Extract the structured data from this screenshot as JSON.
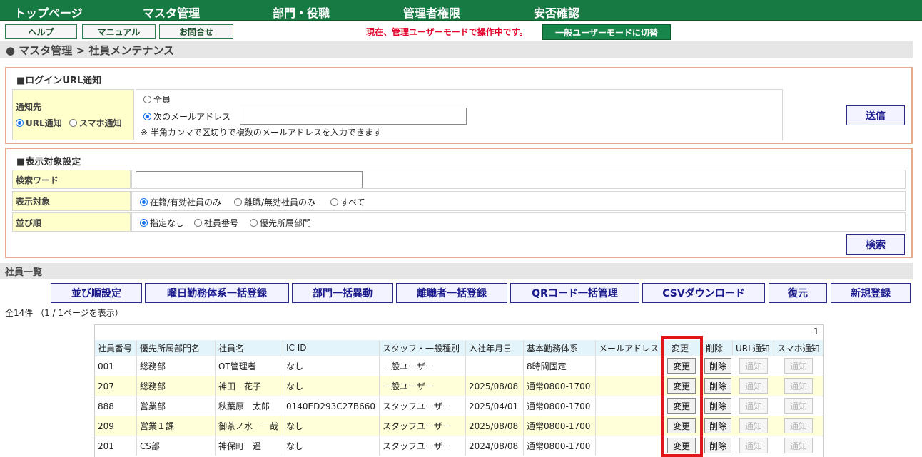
{
  "nav": {
    "items": [
      "トップページ",
      "マスタ管理",
      "部門・役職",
      "管理者権限",
      "安否確認"
    ]
  },
  "utility": {
    "help": "ヘルプ",
    "manual": "マニュアル",
    "contact": "お問合せ",
    "mode_notice": "現在、管理ユーザーモードで操作中です。",
    "switch_mode": "一般ユーザーモードに切替"
  },
  "breadcrumb": "● マスタ管理 > 社員メンテナンス",
  "login_url": {
    "title": "■ログインURL通知",
    "target_label": "通知先",
    "method_url": "URL通知",
    "method_sp": "スマホ通知",
    "all": "全員",
    "addresses": "次のメールアドレス",
    "address_value": "",
    "note": "※ 半角カンマで区切りで複数のメールアドレスを入力できます",
    "send": "送信"
  },
  "display": {
    "title": "■表示対象設定",
    "keyword_label": "検索ワード",
    "keyword_value": "",
    "target_label": "表示対象",
    "target_options": [
      "在籍/有効社員のみ",
      "離職/無効社員のみ",
      "すべて"
    ],
    "order_label": "並び順",
    "order_options": [
      "指定なし",
      "社員番号",
      "優先所属部門"
    ],
    "search": "検索"
  },
  "list": {
    "title": "社員一覧",
    "actions": [
      "並び順設定",
      "曜日勤務体系一括登録",
      "部門一括異動",
      "離職者一括登録",
      "QRコード一括管理",
      "CSVダウンロード",
      "復元",
      "新規登録"
    ],
    "count": "全14件 （1 / 1ページを表示）",
    "page": "1",
    "columns": [
      "社員番号",
      "優先所属部門名",
      "社員名",
      "IC ID",
      "スタッフ・一般種別",
      "入社年月日",
      "基本勤務体系",
      "メールアドレス",
      "変更",
      "削除",
      "URL通知",
      "スマホ通知"
    ],
    "edit_label": "変更",
    "delete_label": "削除",
    "notify_label": "通知",
    "rows": [
      {
        "no": "001",
        "dept": "総務部",
        "name": "OT管理者",
        "ic": "なし",
        "type": "一般ユーザー",
        "date": "",
        "shift": "8時間固定",
        "mail": ""
      },
      {
        "no": "207",
        "dept": "総務部",
        "name": "神田　花子",
        "ic": "なし",
        "type": "一般ユーザー",
        "date": "2025/08/08",
        "shift": "通常0800-1700",
        "mail": ""
      },
      {
        "no": "888",
        "dept": "営業部",
        "name": "秋葉原　太郎",
        "ic": "0140ED293C27B660",
        "type": "スタッフユーザー",
        "date": "2025/04/01",
        "shift": "通常0800-1700",
        "mail": ""
      },
      {
        "no": "209",
        "dept": "営業１課",
        "name": "御茶ノ水　一哉",
        "ic": "なし",
        "type": "スタッフユーザー",
        "date": "2025/08/08",
        "shift": "通常0800-1700",
        "mail": ""
      },
      {
        "no": "201",
        "dept": "CS部",
        "name": "神保町　遥",
        "ic": "なし",
        "type": "スタッフユーザー",
        "date": "2024/08/08",
        "shift": "通常0800-1700",
        "mail": ""
      }
    ]
  },
  "colors": {
    "nav_bg": "#177a42",
    "panel_border": "#e9a98c",
    "label_bg": "#ffffcc",
    "header_bg": "#e4f4fb",
    "highlight": "#e0161b"
  }
}
